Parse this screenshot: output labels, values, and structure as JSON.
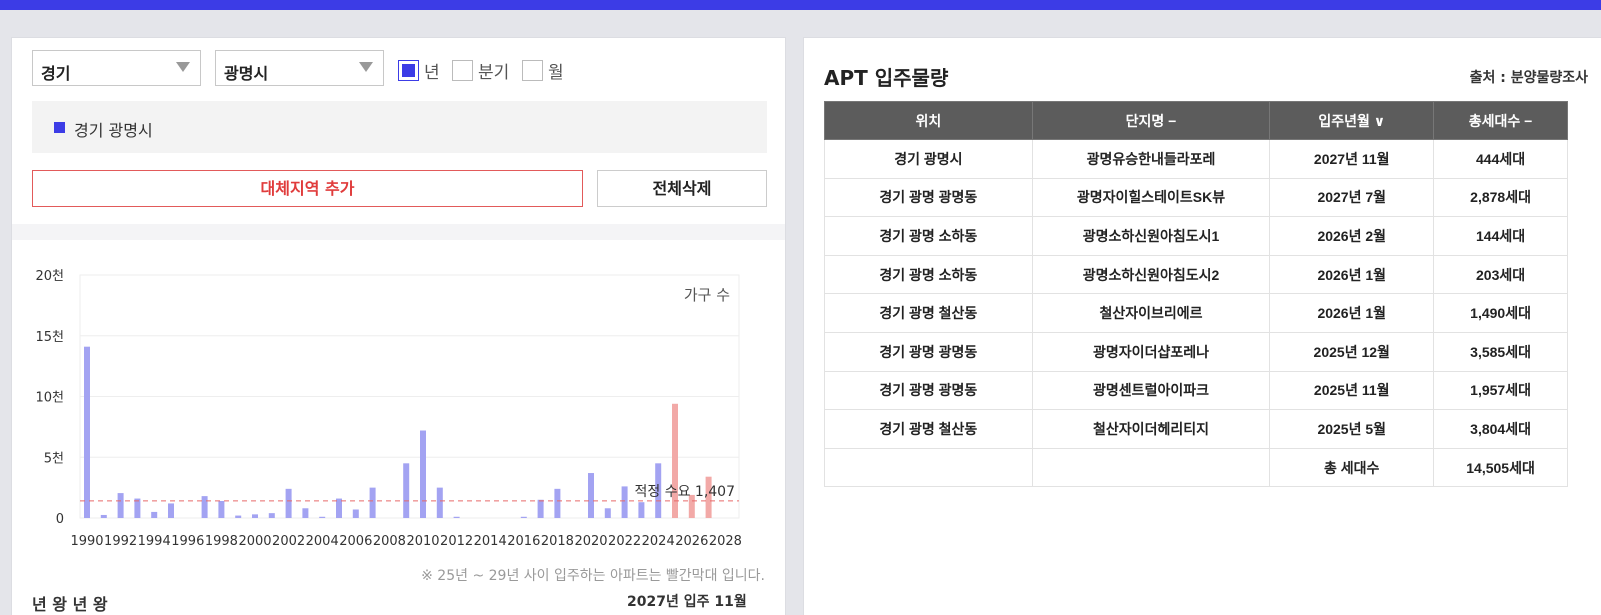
{
  "filters": {
    "province": "경기",
    "city": "광명시",
    "periods": [
      {
        "label": "년",
        "checked": true
      },
      {
        "label": "분기",
        "checked": false
      },
      {
        "label": "월",
        "checked": false
      }
    ]
  },
  "selected_region": "경기 광명시",
  "buttons": {
    "add_region": "대체지역 추가",
    "clear_all": "전체삭제"
  },
  "chart_note": "※ 25년 ~ 29년 사이 입주하는 아파트는 빨간막대 입니다.",
  "cut_off_text": {
    "left": "년 왕  년 왕",
    "right": "2027년 입주 11월"
  },
  "chart_data": {
    "type": "bar",
    "series_label": "가구 수",
    "y_tick_labels": [
      "0",
      "5천",
      "10천",
      "15천",
      "20천"
    ],
    "y_ticks": [
      0,
      5000,
      10000,
      15000,
      20000
    ],
    "ylim": [
      0,
      20000
    ],
    "x_tick_labels": [
      "1990",
      "1992",
      "1994",
      "1996",
      "1998",
      "2000",
      "2002",
      "2004",
      "2006",
      "2008",
      "2010",
      "2012",
      "2014",
      "2016",
      "2018",
      "2020",
      "2022",
      "2024",
      "2026",
      "2028"
    ],
    "years": [
      1990,
      1991,
      1992,
      1993,
      1994,
      1995,
      1996,
      1997,
      1998,
      1999,
      2000,
      2001,
      2002,
      2003,
      2004,
      2005,
      2006,
      2007,
      2008,
      2009,
      2010,
      2011,
      2012,
      2013,
      2014,
      2015,
      2016,
      2017,
      2018,
      2019,
      2020,
      2021,
      2022,
      2023,
      2024,
      2025,
      2026,
      2027,
      2028
    ],
    "values": [
      14100,
      250,
      2050,
      1600,
      500,
      1200,
      0,
      1800,
      1400,
      200,
      300,
      400,
      2400,
      800,
      100,
      1600,
      700,
      2500,
      0,
      4500,
      7200,
      2500,
      100,
      0,
      0,
      0,
      100,
      1500,
      2400,
      0,
      3700,
      800,
      2600,
      1300,
      4500,
      9400,
      1900,
      3400,
      0
    ],
    "highlight_range": [
      2025,
      2029
    ],
    "reference_line": {
      "label": "적정 수요",
      "value_label": "1,407",
      "value": 1407
    },
    "colors": {
      "normal": "#a3a3f2",
      "highlight": "#f2a9a7",
      "reference": "#e86a6a",
      "grid": "#eeeeee"
    },
    "grid": true
  },
  "apt": {
    "title": "APT 입주물량",
    "source": "출처 : 분양물량조사",
    "headers": [
      "위치",
      "단지명 −",
      "입주년월 ∨",
      "총세대수 −"
    ],
    "rows": [
      [
        "경기 광명시",
        "광명유승한내들라포레",
        "2027년 11월",
        "444세대"
      ],
      [
        "경기 광명 광명동",
        "광명자이힐스테이트SK뷰",
        "2027년 7월",
        "2,878세대"
      ],
      [
        "경기 광명 소하동",
        "광명소하신원아침도시1",
        "2026년 2월",
        "144세대"
      ],
      [
        "경기 광명 소하동",
        "광명소하신원아침도시2",
        "2026년 1월",
        "203세대"
      ],
      [
        "경기 광명 철산동",
        "철산자이브리에르",
        "2026년 1월",
        "1,490세대"
      ],
      [
        "경기 광명 광명동",
        "광명자이더샵포레나",
        "2025년 12월",
        "3,585세대"
      ],
      [
        "경기 광명 광명동",
        "광명센트럴아이파크",
        "2025년 11월",
        "1,957세대"
      ],
      [
        "경기 광명 철산동",
        "철산자이더헤리티지",
        "2025년 5월",
        "3,804세대"
      ]
    ],
    "total_label": "총 세대수",
    "total_value": "14,505세대"
  }
}
